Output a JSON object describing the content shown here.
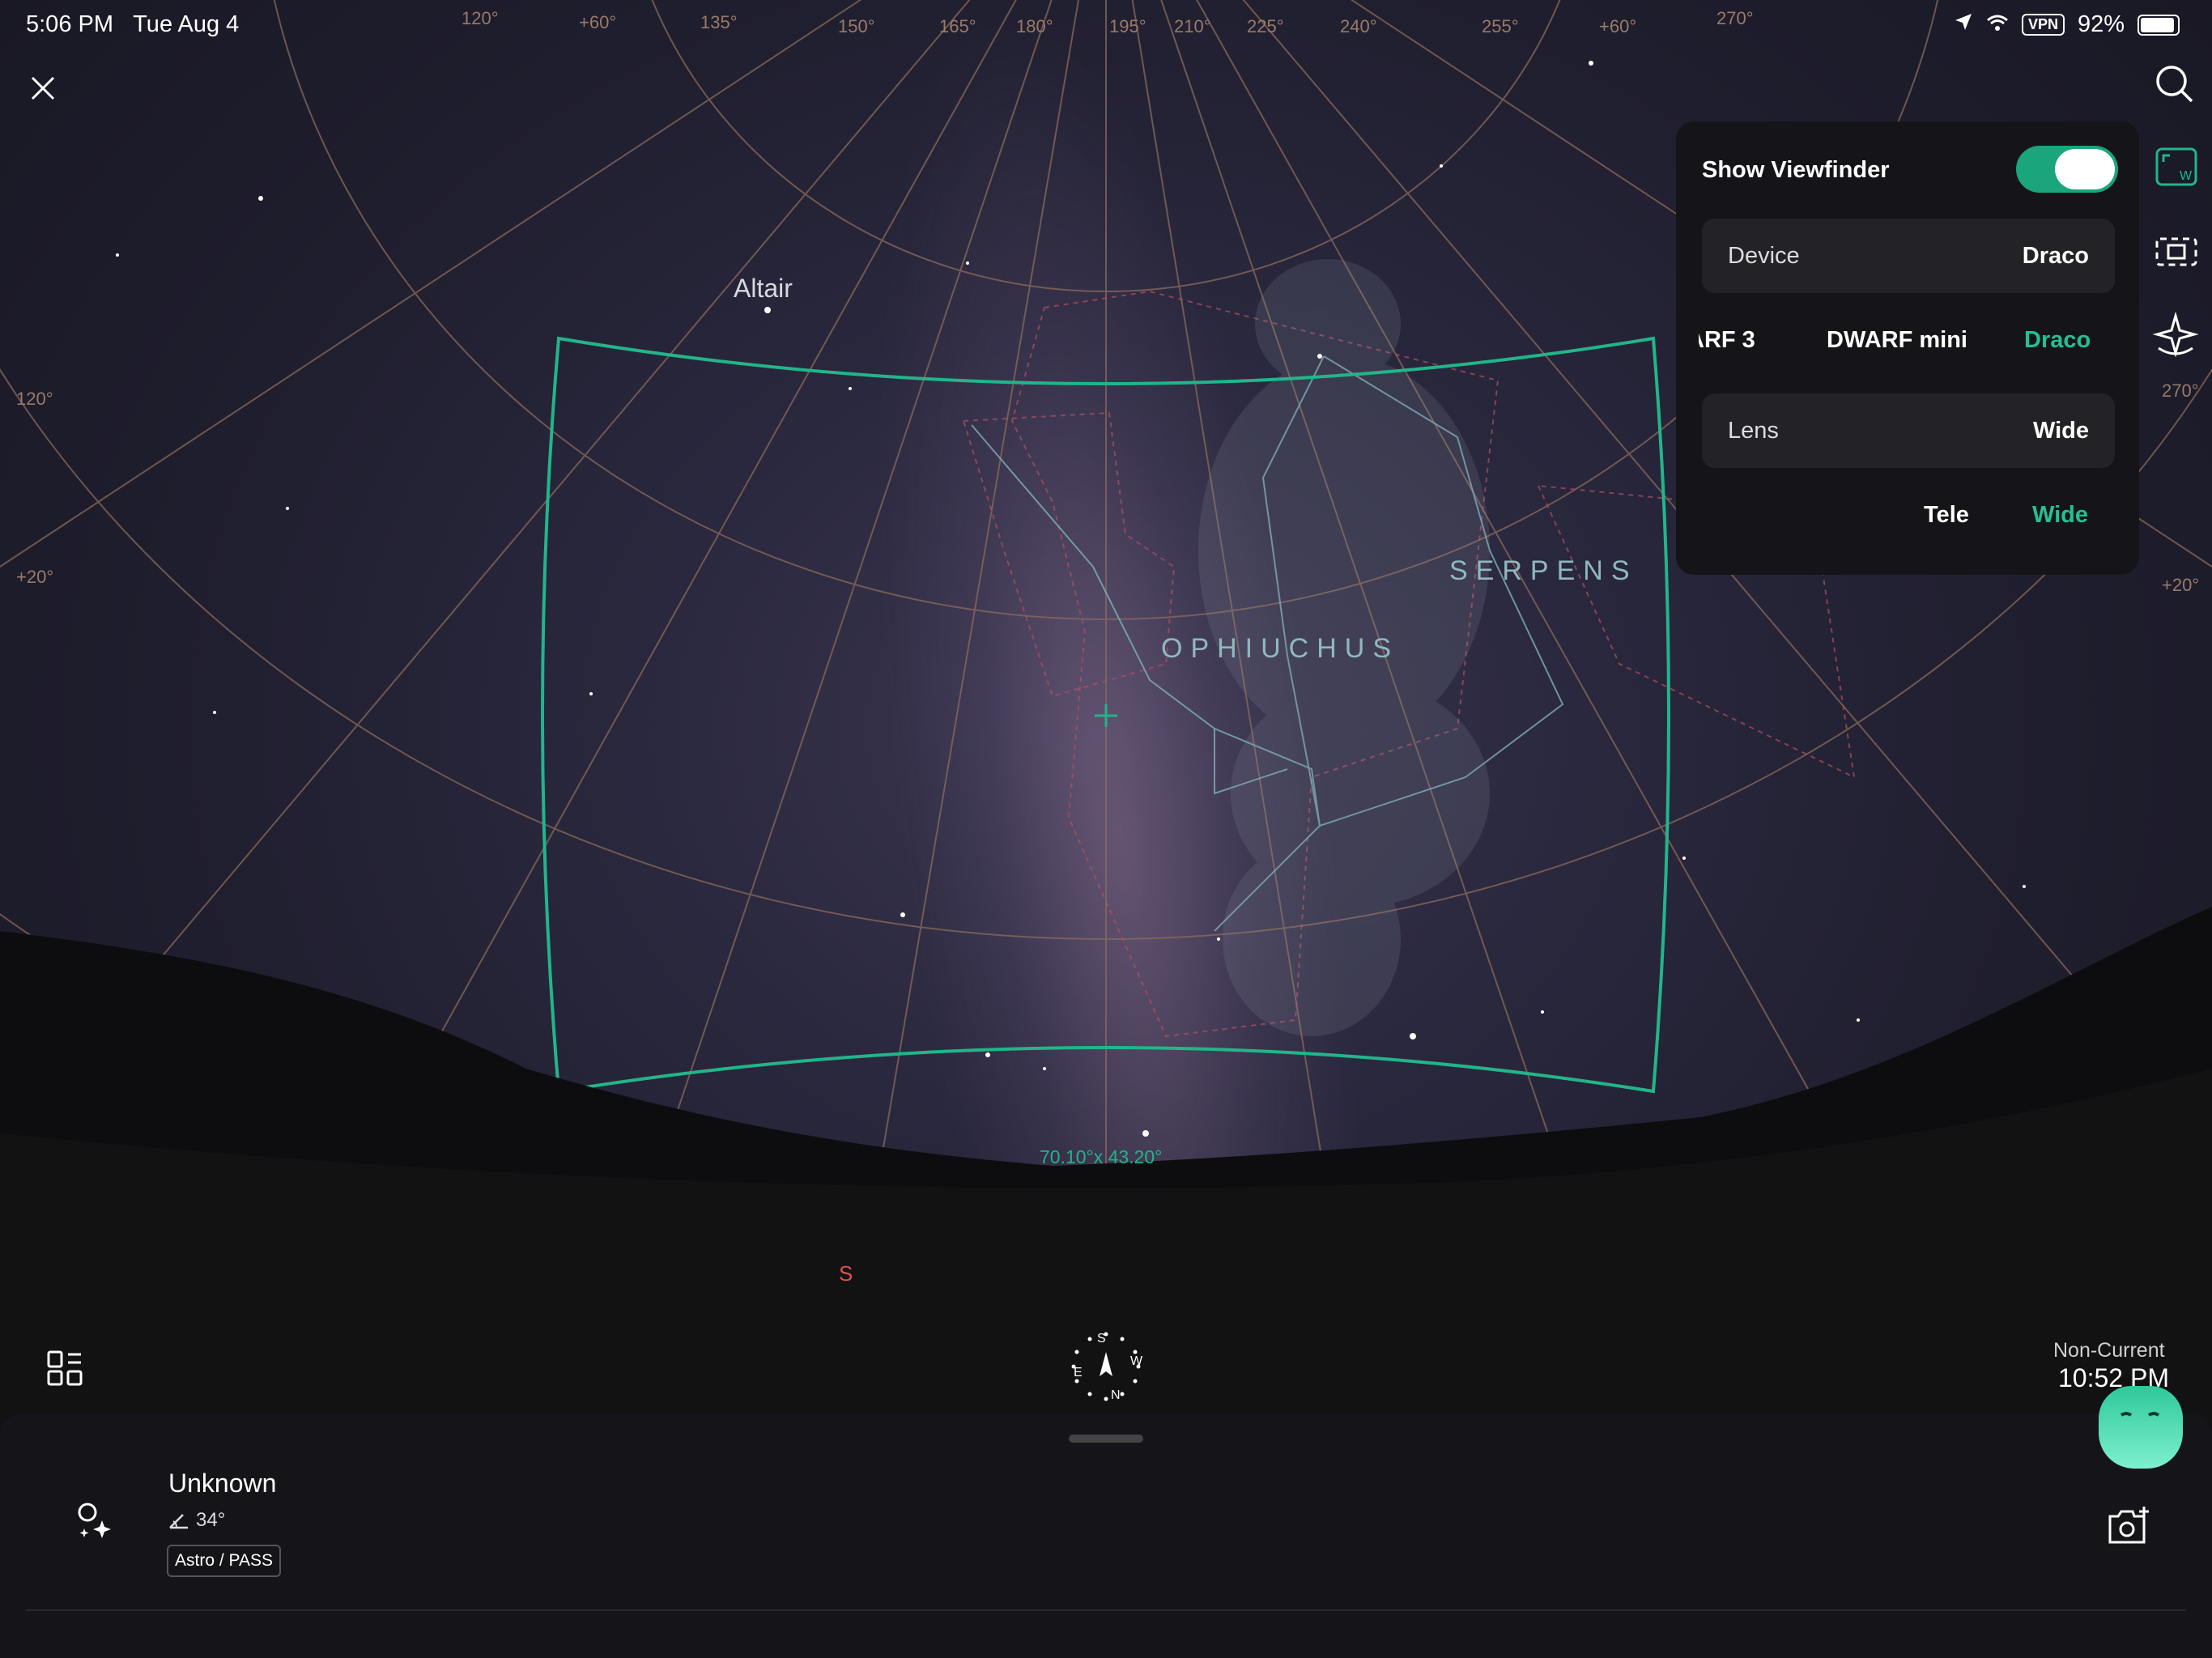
{
  "status_bar": {
    "time": "5:06 PM",
    "date": "Tue Aug 4",
    "vpn": "VPN",
    "battery": "92%"
  },
  "sky": {
    "star_label": "Altair",
    "constellations": [
      "OPHIUCHUS",
      "SERPENS"
    ],
    "fov": "70.10°x 43.20°",
    "direction": "S",
    "grid_labels": [
      "120°",
      "+60°",
      "135°",
      "150°",
      "165°",
      "180°",
      "195°",
      "210°",
      "225°",
      "240°",
      "255°",
      "+60°",
      "270°",
      "120°",
      "+20°",
      "+20°",
      "270°",
      "+20°"
    ]
  },
  "viewfinder_panel": {
    "show_viewfinder_label": "Show Viewfinder",
    "show_viewfinder_on": true,
    "device_label": "Device",
    "device_value": "Draco",
    "device_options": [
      "ARF 3",
      "DWARF mini",
      "Draco"
    ],
    "device_selected": "Draco",
    "lens_label": "Lens",
    "lens_value": "Wide",
    "lens_options": [
      "Tele",
      "Wide"
    ],
    "lens_selected": "Wide"
  },
  "time_display": {
    "mode": "Non-Current",
    "time": "10:52 PM"
  },
  "bottom_sheet": {
    "target_name": "Unknown",
    "altitude": "34°",
    "tag": "Astro / PASS"
  },
  "compass": {
    "letters": [
      "S",
      "W",
      "N",
      "E"
    ]
  },
  "colors": {
    "accent": "#25c08f",
    "panel_bg": "#151519",
    "grid_line": "#8a6a5a"
  },
  "icons": [
    "close-icon",
    "search-icon",
    "viewfinder-wide-icon",
    "framing-icon",
    "sparkle-icon",
    "grid-menu-icon",
    "compass-icon",
    "target-star-icon",
    "camera-add-icon",
    "assistant-face-icon",
    "location-arrow-icon",
    "wifi-icon",
    "battery-icon"
  ]
}
